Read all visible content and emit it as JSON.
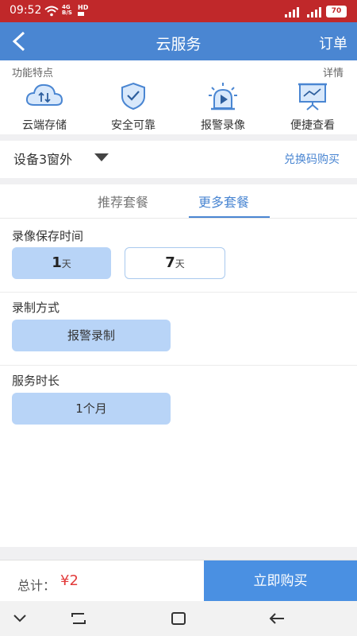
{
  "status_bar": {
    "time": "09:52",
    "net_label_top": "4G",
    "net_label_bottom": "B/S",
    "hd": "HD",
    "battery": "70"
  },
  "nav": {
    "title": "云服务",
    "order": "订单"
  },
  "features": {
    "label": "功能特点",
    "details": "详情",
    "items": [
      {
        "label": "云端存储",
        "icon": "cloud-upload-icon"
      },
      {
        "label": "安全可靠",
        "icon": "shield-check-icon"
      },
      {
        "label": "报警录像",
        "icon": "alarm-video-icon"
      },
      {
        "label": "便捷查看",
        "icon": "presentation-icon"
      }
    ]
  },
  "device": {
    "name": "设备3窗外",
    "redeem": "兑换码购买"
  },
  "tabs": [
    {
      "label": "推荐套餐",
      "active": false
    },
    {
      "label": "更多套餐",
      "active": true
    }
  ],
  "retention": {
    "title": "录像保存时间",
    "options": [
      {
        "value": "1",
        "unit": "天",
        "selected": true
      },
      {
        "value": "7",
        "unit": "天",
        "selected": false
      }
    ]
  },
  "record_mode": {
    "title": "录制方式",
    "option": "报警录制"
  },
  "duration": {
    "title": "服务时长",
    "option": "1个月"
  },
  "footer": {
    "total_label": "总计：",
    "price": "¥2",
    "buy": "立即购买"
  },
  "colors": {
    "status_bar": "#c0282a",
    "nav": "#4a86d2",
    "accent": "#4a90e2",
    "selected": "#b8d4f7",
    "price": "#e23b3b"
  }
}
